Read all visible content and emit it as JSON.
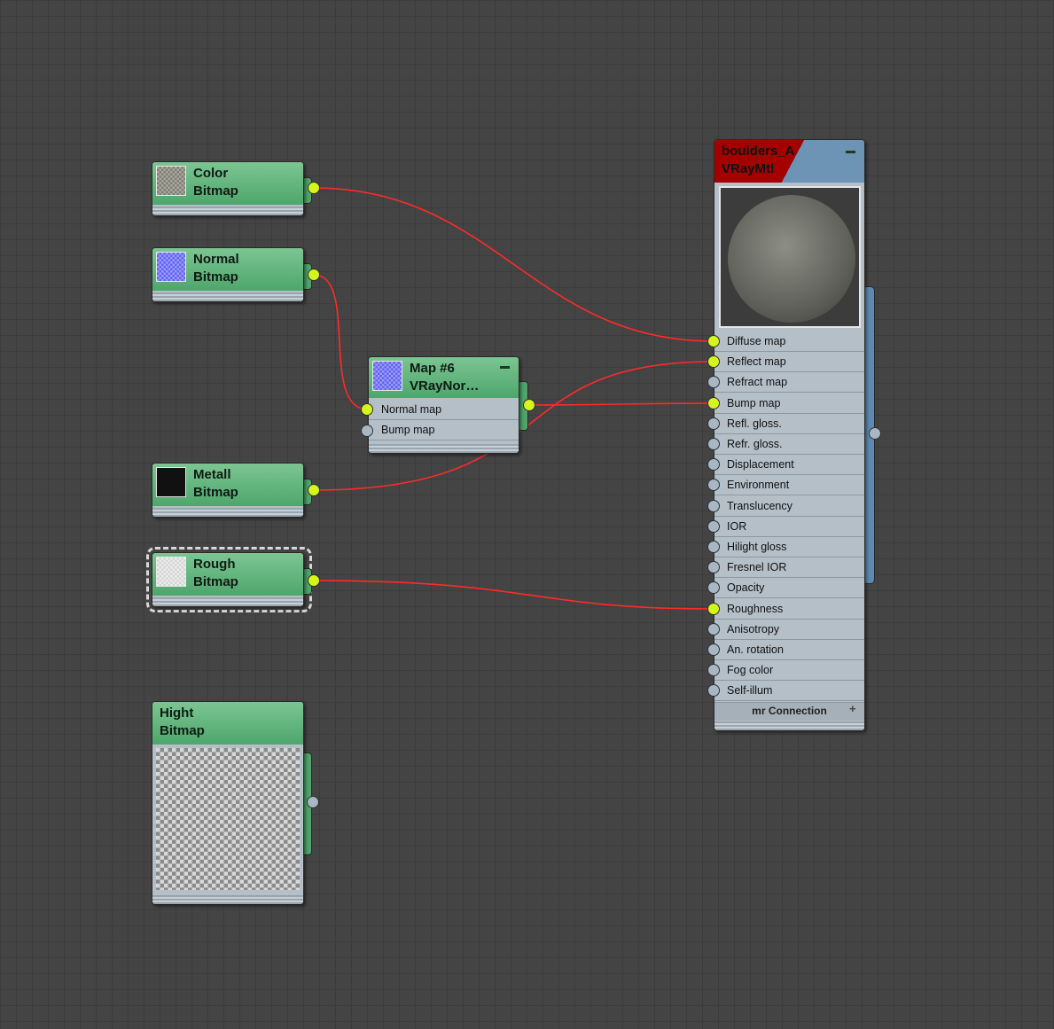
{
  "colors": {
    "background": "#444444",
    "node_header": "#5cb37a",
    "node_body": "#b5bfc8",
    "material_header": "#6d93b5",
    "material_header_accent": "#a50000",
    "wire": "#ff2a2a",
    "socket_connected": "#d6f51a",
    "socket_empty": "#a9b6c3"
  },
  "nodes": {
    "color": {
      "title": "Color",
      "subtitle": "Bitmap",
      "thumb": "gray-stone-thumbnail"
    },
    "normal": {
      "title": "Normal",
      "subtitle": "Bitmap",
      "thumb": "blue-normal-map-thumbnail"
    },
    "metall": {
      "title": "Metall",
      "subtitle": "Bitmap",
      "thumb": "black-thumbnail"
    },
    "rough": {
      "title": "Rough",
      "subtitle": "Bitmap",
      "thumb": "light-gray-thumbnail"
    },
    "hight": {
      "title": "Hight",
      "subtitle": "Bitmap",
      "thumb": "heightmap-preview"
    },
    "map6": {
      "title": "Map #6",
      "subtitle": "VRayNor…",
      "thumb": "blue-normal-map-thumbnail",
      "inputs": [
        "Normal map",
        "Bump map"
      ]
    }
  },
  "material": {
    "title": "boulders_A",
    "subtitle": "VRayMtl",
    "preview": "stone-sphere-preview",
    "slots": [
      "Diffuse map",
      "Reflect map",
      "Refract map",
      "Bump map",
      "Refl. gloss.",
      "Refr. gloss.",
      "Displacement",
      "Environment",
      "Translucency",
      "IOR",
      "Hilight gloss",
      "Fresnel IOR",
      "Opacity",
      "Roughness",
      "Anisotropy",
      "An. rotation",
      "Fog color",
      "Self-illum"
    ],
    "connected_slots": [
      "Diffuse map",
      "Reflect map",
      "Bump map",
      "Roughness"
    ],
    "footer": "mr Connection"
  }
}
